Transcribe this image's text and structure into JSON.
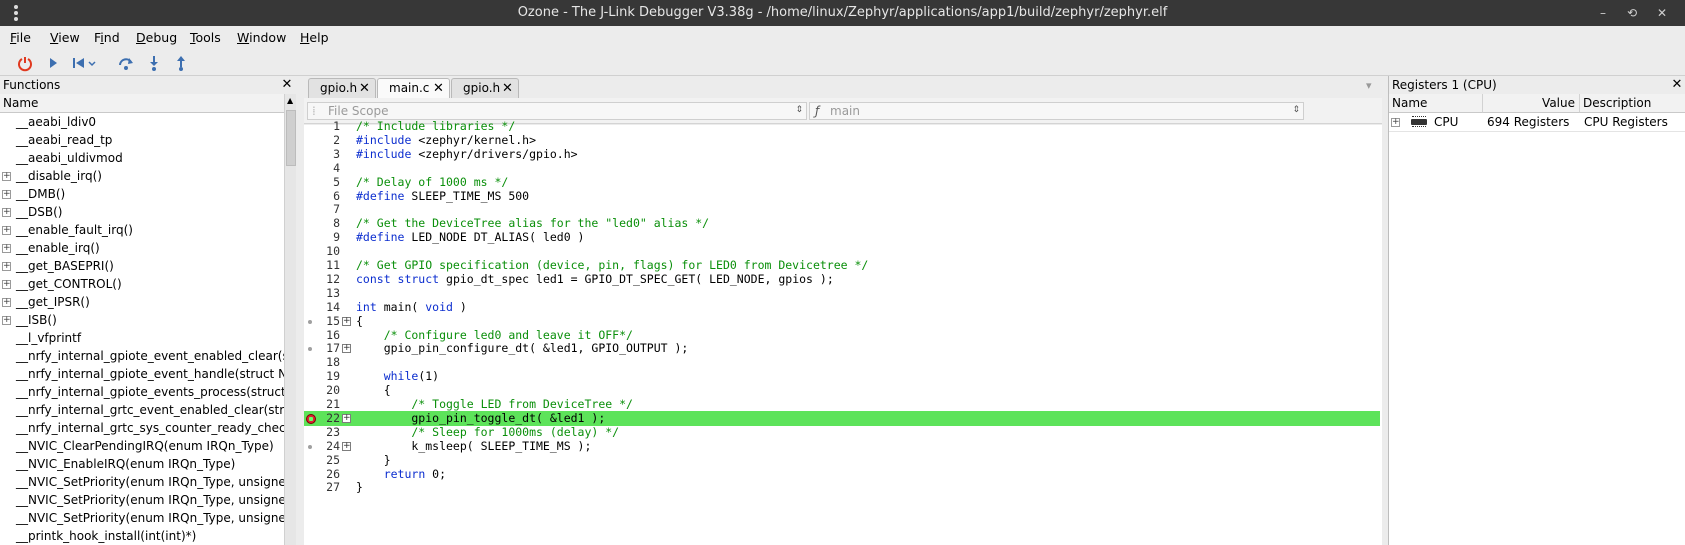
{
  "window": {
    "title": "Ozone - The J-Link Debugger V3.38g - /home/linux/Zephyr/applications/app1/build/zephyr/zephyr.elf",
    "minimize": "–",
    "restore": "⟲",
    "close": "✕"
  },
  "menu": [
    {
      "pre": "",
      "key": "F",
      "post": "ile"
    },
    {
      "pre": "",
      "key": "V",
      "post": "iew"
    },
    {
      "pre": "F",
      "key": "i",
      "post": "nd"
    },
    {
      "pre": "",
      "key": "D",
      "post": "ebug"
    },
    {
      "pre": "",
      "key": "T",
      "post": "ools"
    },
    {
      "pre": "",
      "key": "W",
      "post": "indow"
    },
    {
      "pre": "",
      "key": "H",
      "post": "elp"
    }
  ],
  "functions": {
    "title": "Functions",
    "column": "Name",
    "items": [
      {
        "name": "__aeabi_ldiv0",
        "expandable": false
      },
      {
        "name": "__aeabi_read_tp",
        "expandable": false
      },
      {
        "name": "__aeabi_uldivmod",
        "expandable": false
      },
      {
        "name": "__disable_irq()",
        "expandable": true
      },
      {
        "name": "__DMB()",
        "expandable": true
      },
      {
        "name": "__DSB()",
        "expandable": true
      },
      {
        "name": "__enable_fault_irq()",
        "expandable": true
      },
      {
        "name": "__enable_irq()",
        "expandable": true
      },
      {
        "name": "__get_BASEPRI()",
        "expandable": true
      },
      {
        "name": "__get_CONTROL()",
        "expandable": true
      },
      {
        "name": "__get_IPSR()",
        "expandable": true
      },
      {
        "name": "__ISB()",
        "expandable": true
      },
      {
        "name": "__l_vfprintf",
        "expandable": false
      },
      {
        "name": "__nrfy_internal_gpiote_event_enabled_clear(struct NRF_",
        "expandable": false
      },
      {
        "name": "__nrfy_internal_gpiote_event_handle(struct NRF_GPIOTE_",
        "expandable": false
      },
      {
        "name": "__nrfy_internal_gpiote_events_process(struct NRF_GPIOTE",
        "expandable": false
      },
      {
        "name": "__nrfy_internal_grtc_event_enabled_clear(struct NRF_GRT",
        "expandable": false
      },
      {
        "name": "__nrfy_internal_grtc_sys_counter_ready_check(const struct",
        "expandable": false
      },
      {
        "name": "__NVIC_ClearPendingIRQ(enum IRQn_Type)",
        "expandable": false
      },
      {
        "name": "__NVIC_EnableIRQ(enum IRQn_Type)",
        "expandable": false
      },
      {
        "name": "__NVIC_SetPriority(enum IRQn_Type, unsigned int)",
        "expandable": false
      },
      {
        "name": "__NVIC_SetPriority(enum IRQn_Type, unsigned int)",
        "expandable": false
      },
      {
        "name": "__NVIC_SetPriority(enum IRQn_Type, unsigned int)",
        "expandable": false
      },
      {
        "name": "__printk_hook_install(int(int)*)",
        "expandable": false
      }
    ]
  },
  "editor": {
    "tabs": [
      {
        "label": "gpio.h",
        "close": "✕"
      },
      {
        "label": "main.c",
        "close": "✕"
      },
      {
        "label": "gpio.h",
        "close": "✕"
      }
    ],
    "overflow": "▾",
    "scope_placeholder": "File Scope",
    "function_placeholder": "main",
    "function_glyph": "ƒ",
    "lines": [
      {
        "n": "1",
        "segs": [
          {
            "t": "/* Include libraries */",
            "c": "comment"
          }
        ]
      },
      {
        "n": "2",
        "segs": [
          {
            "t": "#include",
            "c": "kw"
          },
          {
            "t": " <zephyr/kernel.h>",
            "c": "plain"
          }
        ]
      },
      {
        "n": "3",
        "segs": [
          {
            "t": "#include",
            "c": "kw"
          },
          {
            "t": " <zephyr/drivers/gpio.h>",
            "c": "plain"
          }
        ]
      },
      {
        "n": "4",
        "segs": []
      },
      {
        "n": "5",
        "segs": [
          {
            "t": "/* Delay of 1000 ms */",
            "c": "comment"
          }
        ]
      },
      {
        "n": "6",
        "segs": [
          {
            "t": "#define",
            "c": "kw"
          },
          {
            "t": " SLEEP_TIME_MS 500",
            "c": "plain"
          }
        ]
      },
      {
        "n": "7",
        "segs": []
      },
      {
        "n": "8",
        "segs": [
          {
            "t": "/* Get the DeviceTree alias for the \"led0\" alias */",
            "c": "comment"
          }
        ]
      },
      {
        "n": "9",
        "segs": [
          {
            "t": "#define",
            "c": "kw"
          },
          {
            "t": " LED_NODE DT_ALIAS( led0 )",
            "c": "plain"
          }
        ]
      },
      {
        "n": "10",
        "segs": []
      },
      {
        "n": "11",
        "segs": [
          {
            "t": "/* Get GPIO specification (device, pin, flags) for LED0 from Devicetree */",
            "c": "comment"
          }
        ]
      },
      {
        "n": "12",
        "segs": [
          {
            "t": "const struct",
            "c": "kw"
          },
          {
            "t": " gpio_dt_spec led1 = GPIO_DT_SPEC_GET( LED_NODE, gpios );",
            "c": "plain"
          }
        ]
      },
      {
        "n": "13",
        "segs": []
      },
      {
        "n": "14",
        "segs": [
          {
            "t": "int",
            "c": "kw"
          },
          {
            "t": " main( ",
            "c": "plain"
          },
          {
            "t": "void",
            "c": "kw"
          },
          {
            "t": " )",
            "c": "plain"
          }
        ]
      },
      {
        "n": "15",
        "bp": "dot",
        "fold": true,
        "segs": [
          {
            "t": "{",
            "c": "plain"
          }
        ]
      },
      {
        "n": "16",
        "segs": [
          {
            "t": "    /* Configure led0 and leave it OFF*/",
            "c": "comment"
          }
        ]
      },
      {
        "n": "17",
        "bp": "dot",
        "fold": true,
        "segs": [
          {
            "t": "    gpio_pin_configure_dt( &led1, GPIO_OUTPUT );",
            "c": "plain"
          }
        ]
      },
      {
        "n": "18",
        "segs": []
      },
      {
        "n": "19",
        "segs": [
          {
            "t": "    ",
            "c": "plain"
          },
          {
            "t": "while",
            "c": "kw"
          },
          {
            "t": "(1)",
            "c": "plain"
          }
        ]
      },
      {
        "n": "20",
        "segs": [
          {
            "t": "    {",
            "c": "plain"
          }
        ]
      },
      {
        "n": "21",
        "segs": [
          {
            "t": "        /* Toggle LED from DeviceTree */",
            "c": "comment"
          }
        ]
      },
      {
        "n": "22",
        "bp": "pc",
        "fold": true,
        "hl": true,
        "segs": [
          {
            "t": "        gpio_pin_toggle_dt( &led1 );",
            "c": "plain"
          }
        ]
      },
      {
        "n": "23",
        "segs": [
          {
            "t": "        /* Sleep for 1000ms (delay) */",
            "c": "comment"
          }
        ]
      },
      {
        "n": "24",
        "bp": "dot",
        "fold": true,
        "segs": [
          {
            "t": "        k_msleep( SLEEP_TIME_MS );",
            "c": "plain"
          }
        ]
      },
      {
        "n": "25",
        "segs": [
          {
            "t": "    }",
            "c": "plain"
          }
        ]
      },
      {
        "n": "26",
        "segs": [
          {
            "t": "    ",
            "c": "plain"
          },
          {
            "t": "return",
            "c": "kw"
          },
          {
            "t": " 0;",
            "c": "plain"
          }
        ]
      },
      {
        "n": "27",
        "segs": [
          {
            "t": "}",
            "c": "plain"
          }
        ]
      }
    ]
  },
  "registers": {
    "title": "Registers 1 (CPU)",
    "columns": {
      "name": "Name",
      "value": "Value",
      "description": "Description"
    },
    "rows": [
      {
        "name": "CPU",
        "value": "694 Registers",
        "description": "CPU Registers"
      }
    ]
  },
  "colors": {
    "current_line": "#5de35a",
    "comment": "#0a8f0a",
    "keyword": "#0c2ecf"
  }
}
